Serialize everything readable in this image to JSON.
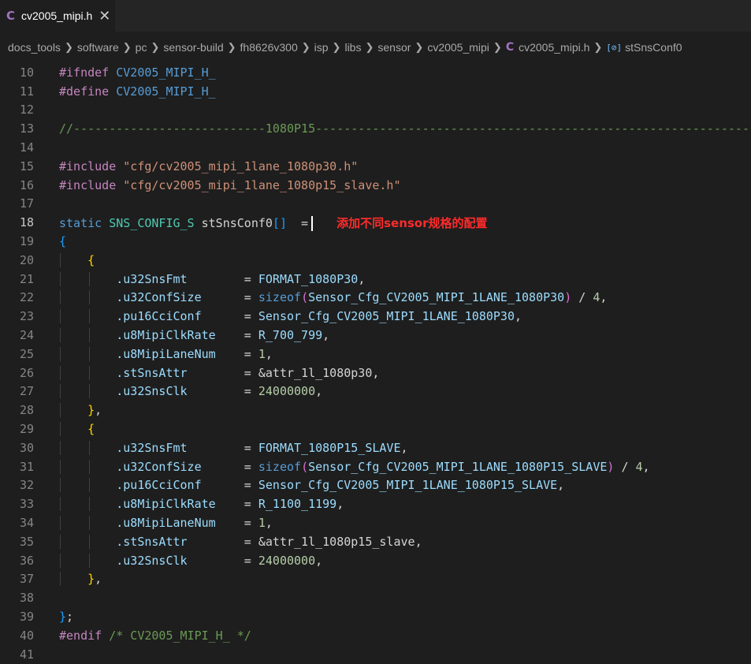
{
  "tab": {
    "icon": "C",
    "title": "cv2005_mipi.h",
    "close": "✕"
  },
  "breadcrumb": {
    "items": [
      "docs_tools",
      "software",
      "pc",
      "sensor-build",
      "fh8626v300",
      "isp",
      "libs",
      "sensor",
      "cv2005_mipi"
    ],
    "file_icon": "C",
    "file": "cv2005_mipi.h",
    "symbol_icon": "[⊘]",
    "symbol": "stSnsConf0"
  },
  "annotation": "添加不同sensor规格的配置",
  "lines": {
    "10": [
      "#ifndef",
      " CV2005_MIPI_H_"
    ],
    "11": [
      "#define",
      " CV2005_MIPI_H_"
    ],
    "13": "//---------------------------1080P15-------------------------------------------------------------",
    "15": [
      "#include",
      " \"cfg/cv2005_mipi_1lane_1080p30.h\""
    ],
    "16": [
      "#include",
      " \"cfg/cv2005_mipi_1lane_1080p15_slave.h\""
    ],
    "18": [
      "static",
      " SNS_CONFIG_S",
      " stSnsConf0",
      "[]",
      "  ="
    ],
    "19": "{",
    "20": "{",
    "21": [
      ".u32SnsFmt",
      "        = ",
      "FORMAT_1080P30",
      ","
    ],
    "22": [
      ".u32ConfSize",
      "      = ",
      "sizeof",
      "(",
      "Sensor_Cfg_CV2005_MIPI_1LANE_1080P30",
      ")",
      " / ",
      "4",
      ","
    ],
    "23": [
      ".pu16CciConf",
      "      = ",
      "Sensor_Cfg_CV2005_MIPI_1LANE_1080P30",
      ","
    ],
    "24": [
      ".u8MipiClkRate",
      "    = ",
      "R_700_799",
      ","
    ],
    "25": [
      ".u8MipiLaneNum",
      "    = ",
      "1",
      ","
    ],
    "26": [
      ".stSnsAttr",
      "        = ",
      "&attr_1l_1080p30",
      ","
    ],
    "27": [
      ".u32SnsClk",
      "        = ",
      "24000000",
      ","
    ],
    "28": [
      "}",
      ","
    ],
    "29": "{",
    "30": [
      ".u32SnsFmt",
      "        = ",
      "FORMAT_1080P15_SLAVE",
      ","
    ],
    "31": [
      ".u32ConfSize",
      "      = ",
      "sizeof",
      "(",
      "Sensor_Cfg_CV2005_MIPI_1LANE_1080P15_SLAVE",
      ")",
      " / ",
      "4",
      ","
    ],
    "32": [
      ".pu16CciConf",
      "      = ",
      "Sensor_Cfg_CV2005_MIPI_1LANE_1080P15_SLAVE",
      ","
    ],
    "33": [
      ".u8MipiClkRate",
      "    = ",
      "R_1100_1199",
      ","
    ],
    "34": [
      ".u8MipiLaneNum",
      "    = ",
      "1",
      ","
    ],
    "35": [
      ".stSnsAttr",
      "        = ",
      "&attr_1l_1080p15_slave",
      ","
    ],
    "36": [
      ".u32SnsClk",
      "        = ",
      "24000000",
      ","
    ],
    "37": [
      "}",
      ","
    ],
    "39": [
      "}",
      ";"
    ],
    "40": [
      "#endif",
      " /* CV2005_MIPI_H_ */"
    ]
  },
  "line_numbers": [
    "10",
    "11",
    "12",
    "13",
    "14",
    "15",
    "16",
    "17",
    "18",
    "19",
    "20",
    "21",
    "22",
    "23",
    "24",
    "25",
    "26",
    "27",
    "28",
    "29",
    "30",
    "31",
    "32",
    "33",
    "34",
    "35",
    "36",
    "37",
    "38",
    "39",
    "40",
    "41"
  ],
  "active_line": "18"
}
